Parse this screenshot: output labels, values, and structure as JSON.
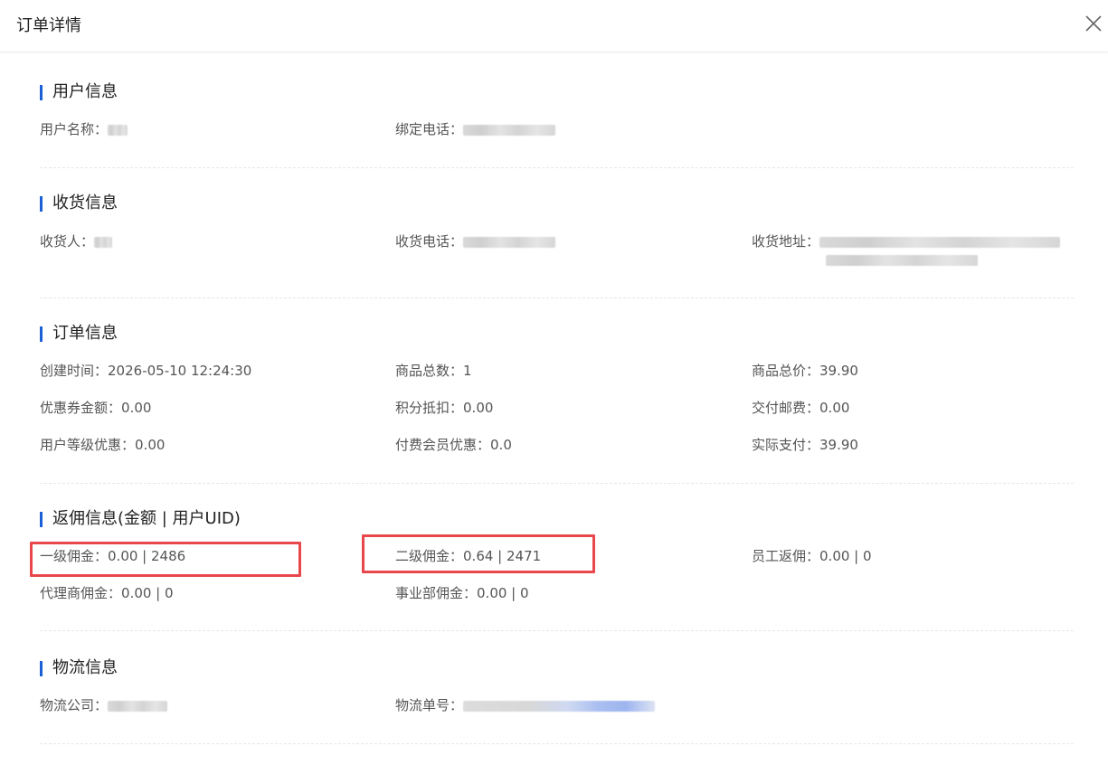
{
  "dialog": {
    "title": "订单详情"
  },
  "user_info": {
    "title": "用户信息",
    "name_label": "用户名称：",
    "phone_label": "绑定电话："
  },
  "shipping_info": {
    "title": "收货信息",
    "receiver_label": "收货人：",
    "phone_label": "收货电话：",
    "address_label": "收货地址："
  },
  "order_info": {
    "title": "订单信息",
    "created_label": "创建时间：",
    "created_value": "2026-05-10 12:24:30",
    "total_count_label": "商品总数：",
    "total_count_value": "1",
    "total_price_label": "商品总价：",
    "total_price_value": "39.90",
    "coupon_label": "优惠券金额：",
    "coupon_value": "0.00",
    "points_label": "积分抵扣：",
    "points_value": "0.00",
    "shipping_fee_label": "交付邮费：",
    "shipping_fee_value": "0.00",
    "level_discount_label": "用户等级优惠：",
    "level_discount_value": "0.00",
    "member_discount_label": "付费会员优惠：",
    "member_discount_value": "0.0",
    "paid_label": "实际支付：",
    "paid_value": "39.90"
  },
  "commission_info": {
    "title": "返佣信息(金额 | 用户UID)",
    "level1_label": "一级佣金：",
    "level1_value": "0.00 | 2486",
    "level2_label": "二级佣金：",
    "level2_value": "0.64 | 2471",
    "staff_label": "员工返佣：",
    "staff_value": "0.00 | 0",
    "agent_label": "代理商佣金：",
    "agent_value": "0.00 | 0",
    "division_label": "事业部佣金：",
    "division_value": "0.00 | 0"
  },
  "logistics_info": {
    "title": "物流信息",
    "company_label": "物流公司：",
    "tracking_label": "物流单号："
  },
  "colors": {
    "accent": "#1a5fd6",
    "highlight": "#e8484b"
  }
}
